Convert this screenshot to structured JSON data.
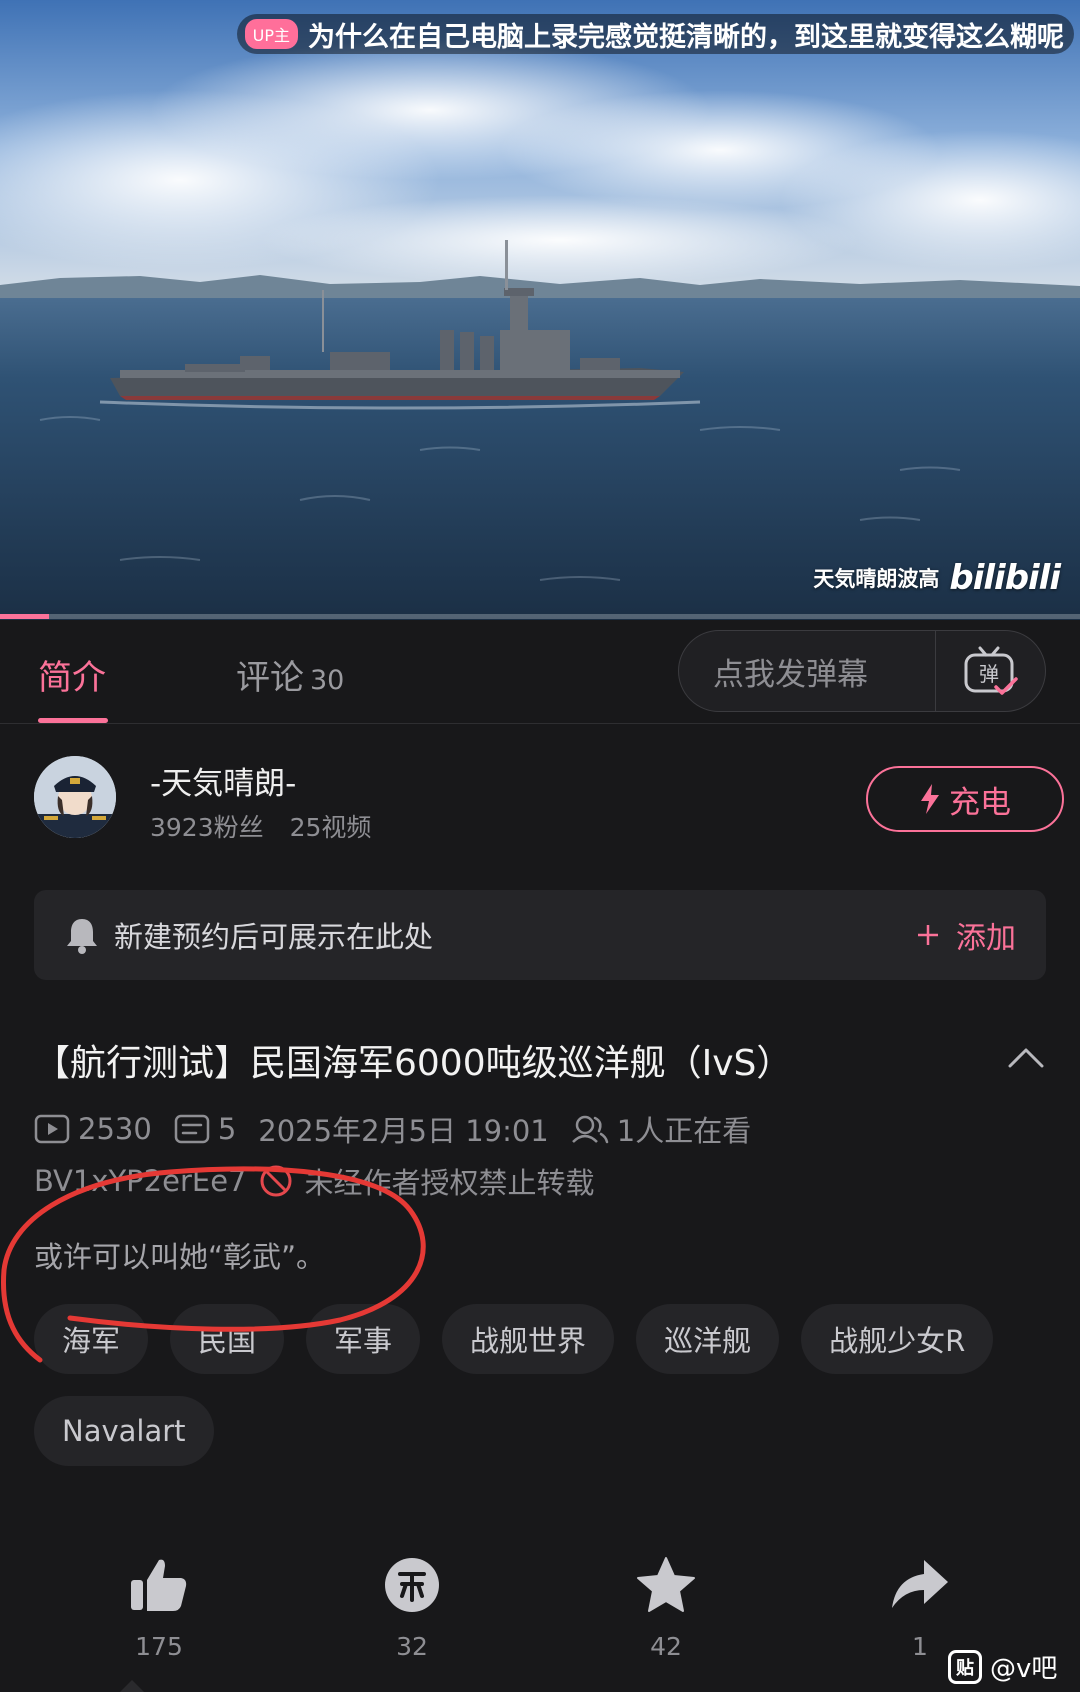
{
  "video": {
    "danmaku": {
      "badge": "UP主",
      "text": "为什么在自己电脑上录完感觉挺清晰的，到这里就变得这么糊呢"
    },
    "watermark": {
      "channel": "天気晴朗波高",
      "logo": "bilibili"
    },
    "progress": 0.045
  },
  "tabs": {
    "intro": "简介",
    "comments": "评论",
    "comments_count": "30",
    "danmaku_placeholder": "点我发弹幕",
    "danmaku_icon": "danmaku-tv-icon"
  },
  "uploader": {
    "name": "-天気晴朗-",
    "fans": "3923粉丝",
    "videos": "25视频",
    "charge_label": "充电"
  },
  "reservation": {
    "text": "新建预约后可展示在此处",
    "add_label": "添加"
  },
  "video_info": {
    "title": "【航行测试】民国海军6000吨级巡洋舰（IvS）",
    "plays": "2530",
    "danmaku_count": "5",
    "date": "2025年2月5日 19:01",
    "watching": "1人正在看",
    "bvid": "BV1xYP2erEe7",
    "copyright": "未经作者授权禁止转载",
    "description": "或许可以叫她“彰武”。"
  },
  "tags": [
    "海军",
    "民国",
    "军事",
    "战舰世界",
    "巡洋舰",
    "战舰少女R",
    "Navalart"
  ],
  "actions": {
    "like": "175",
    "coin": "32",
    "favorite": "42",
    "share": "1"
  },
  "source_mark": {
    "badge": "贴",
    "text": "@v吧"
  },
  "colors": {
    "accent": "#fb7299",
    "background": "#18181a",
    "annotation": "#e53935"
  }
}
